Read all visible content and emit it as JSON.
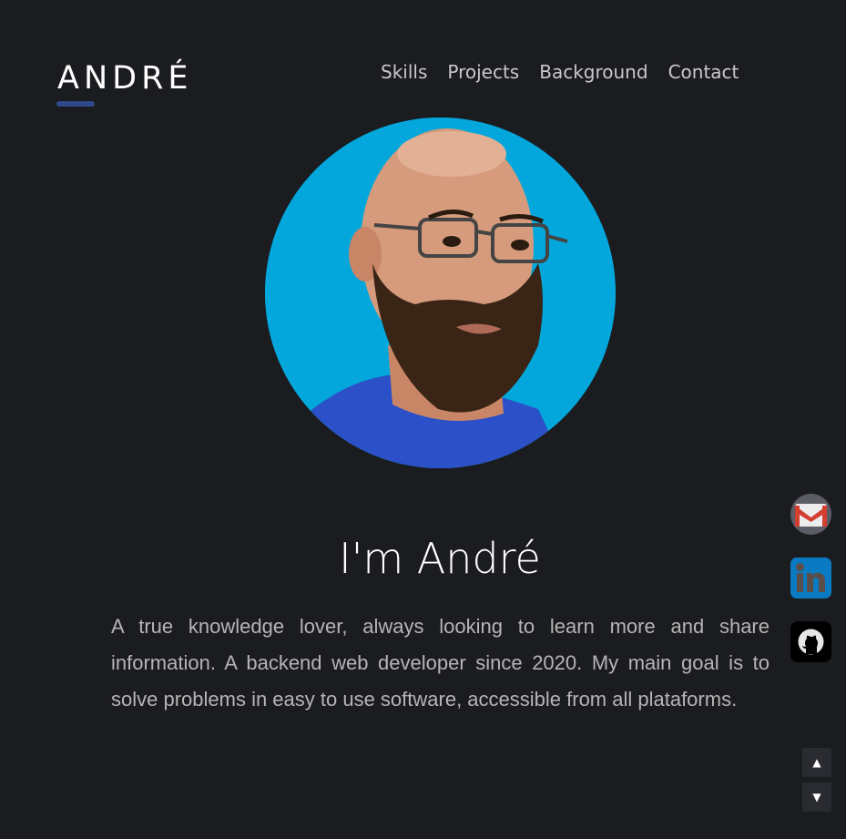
{
  "header": {
    "logo": "ANDRÉ",
    "accent_color": "#2f4a8a",
    "nav": [
      {
        "label": "Skills"
      },
      {
        "label": "Projects"
      },
      {
        "label": "Background"
      },
      {
        "label": "Contact"
      }
    ]
  },
  "hero": {
    "photo_background": "#03a7db",
    "title": "I'm André",
    "description": "A true knowledge lover, always looking to learn more and share information. A backend web developer since 2020. My main goal is to solve problems in easy to use software, accessible from all plataforms."
  },
  "social": [
    {
      "icon": "gmail-icon"
    },
    {
      "icon": "linkedin-icon"
    },
    {
      "icon": "github-icon"
    }
  ],
  "scroll": {
    "up_glyph": "▲",
    "down_glyph": "▼"
  }
}
